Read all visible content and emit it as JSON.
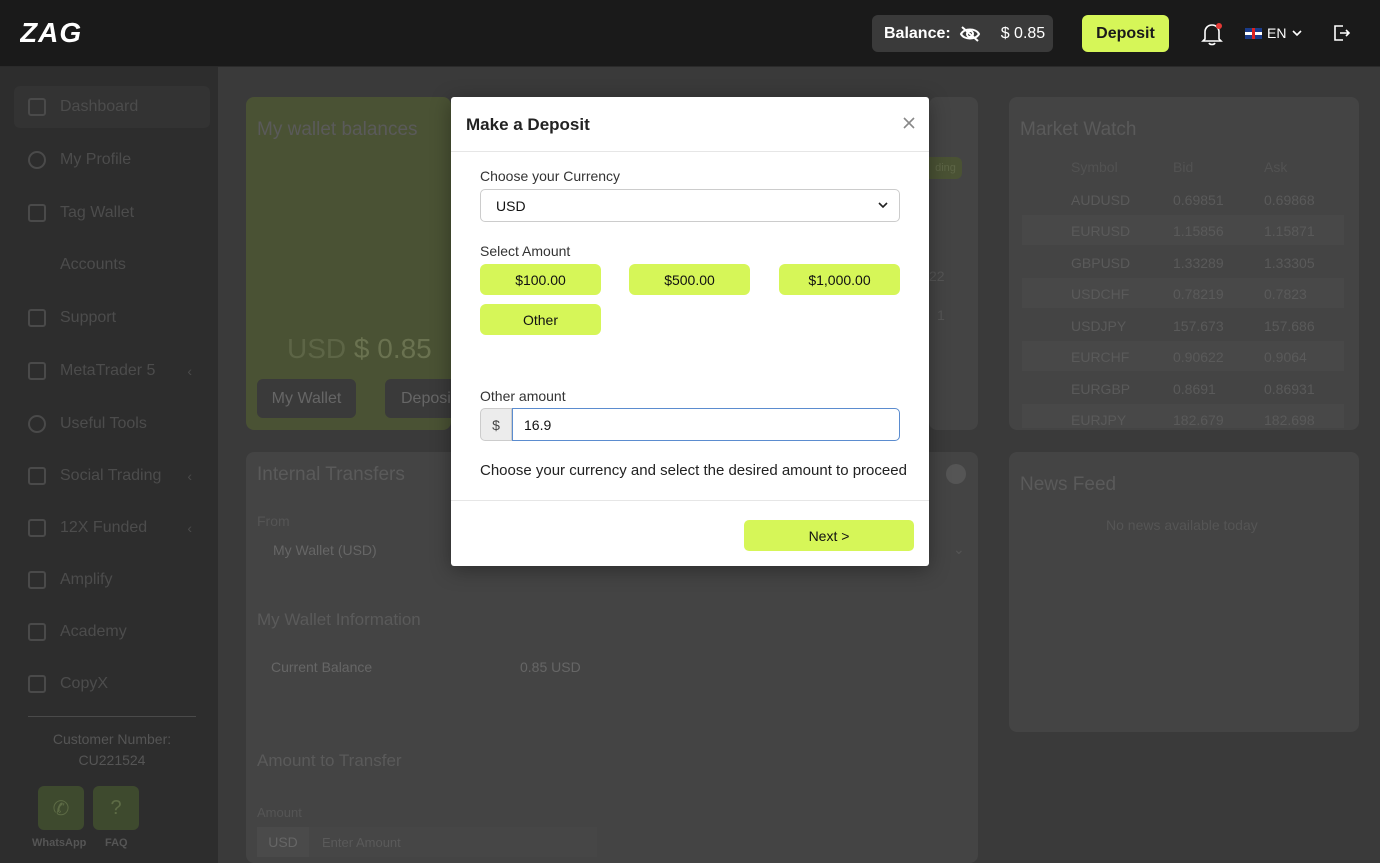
{
  "header": {
    "logo_text": "ZAG",
    "balance_label": "Balance:",
    "balance_value": "$ 0.85",
    "deposit_label": "Deposit",
    "language": "EN"
  },
  "sidebar": {
    "items": [
      {
        "label": "Dashboard"
      },
      {
        "label": "My Profile"
      },
      {
        "label": "Tag Wallet"
      },
      {
        "label": "Accounts"
      },
      {
        "label": "Support"
      },
      {
        "label": "MetaTrader 5"
      },
      {
        "label": "Useful Tools"
      },
      {
        "label": "Social Trading"
      },
      {
        "label": "12X Funded"
      },
      {
        "label": "Amplify"
      },
      {
        "label": "Academy"
      },
      {
        "label": "CopyX"
      }
    ],
    "customer_label": "Customer Number:",
    "customer_number": "CU221524",
    "whatsapp_label": "WhatsApp",
    "faq_label": "FAQ"
  },
  "main": {
    "wallet": {
      "title": "My wallet balances",
      "currency": "USD",
      "amount": "$ 0.85",
      "my_wallet_btn": "My Wallet",
      "deposit_btn": "Deposi",
      "badge": "ding",
      "partial_num": "22",
      "partial_count": "1"
    },
    "transfers": {
      "title": "Internal Transfers",
      "from_label": "From",
      "from_value": "My Wallet (USD)",
      "info_title": "My Wallet Information",
      "current_balance_label": "Current Balance",
      "current_balance_value": "0.85 USD",
      "amount_title": "Amount to Transfer",
      "amount_label": "Amount",
      "amount_currency": "USD",
      "amount_placeholder": "Enter Amount"
    },
    "market_watch": {
      "title": "Market Watch",
      "headers": [
        "Symbol",
        "Bid",
        "Ask"
      ],
      "rows": [
        [
          "AUDUSD",
          "0.69851",
          "0.69868"
        ],
        [
          "EURUSD",
          "1.15856",
          "1.15871"
        ],
        [
          "GBPUSD",
          "1.33289",
          "1.33305"
        ],
        [
          "USDCHF",
          "0.78219",
          "0.7823"
        ],
        [
          "USDJPY",
          "157.673",
          "157.686"
        ],
        [
          "EURCHF",
          "0.90622",
          "0.9064"
        ],
        [
          "EURGBP",
          "0.8691",
          "0.86931"
        ],
        [
          "EURJPY",
          "182.679",
          "182.698"
        ]
      ]
    },
    "news": {
      "title": "News Feed",
      "empty": "No news available today"
    }
  },
  "modal": {
    "title": "Make a Deposit",
    "currency_label": "Choose your Currency",
    "currency_value": "USD",
    "amount_label": "Select Amount",
    "amounts": [
      "$100.00",
      "$500.00",
      "$1,000.00",
      "Other"
    ],
    "other_label": "Other amount",
    "currency_symbol": "$",
    "other_value": "16.9",
    "hint": "Choose your currency and select the desired amount to proceed",
    "next_label": "Next >"
  },
  "colors": {
    "accent": "#d6f658",
    "topbar": "#1a1a1a",
    "overlay_bg": "#3a3a3a"
  }
}
